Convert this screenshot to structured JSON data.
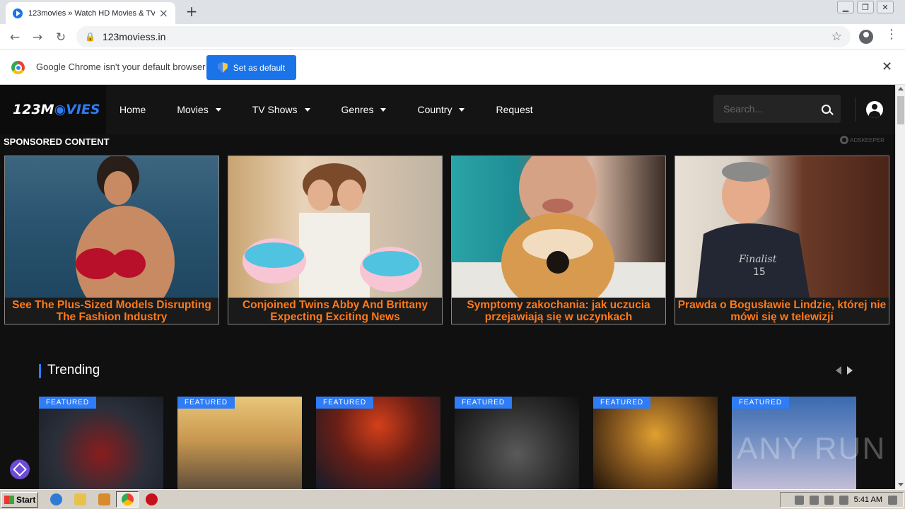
{
  "browser": {
    "tab_title": "123movies » Watch HD Movies & TV",
    "url": "123moviess.in",
    "infobar_message": "Google Chrome isn't your default browser",
    "set_default_label": "Set as default"
  },
  "site": {
    "logo_prefix": "123M",
    "logo_suffix": "VIES",
    "nav": [
      {
        "label": "Home",
        "dropdown": false
      },
      {
        "label": "Movies",
        "dropdown": true
      },
      {
        "label": "TV Shows",
        "dropdown": true
      },
      {
        "label": "Genres",
        "dropdown": true
      },
      {
        "label": "Country",
        "dropdown": true
      },
      {
        "label": "Request",
        "dropdown": false
      }
    ],
    "search_placeholder": "Search..."
  },
  "sponsored": {
    "title": "SPONSORED CONTENT",
    "provider": "ADSKEEPER",
    "cards": [
      {
        "caption": "See The Plus-Sized Models Disrupting The Fashion Industry"
      },
      {
        "caption": "Conjoined Twins Abby And Brittany Expecting Exciting News"
      },
      {
        "caption": "Symptomy zakochania: jak uczucia przejawiają się w uczynkach"
      },
      {
        "caption": "Prawda o Bogusławie Lindzie, której nie mówi się w telewizji"
      }
    ]
  },
  "trending": {
    "title": "Trending",
    "badge": "FEATURED",
    "posters": 6
  },
  "watermark": "ANY RUN",
  "taskbar": {
    "start_label": "Start",
    "clock": "5:41 AM"
  },
  "colors": {
    "accent": "#2e7cf6",
    "caption": "#ff7a1a",
    "site_bg": "#101010"
  }
}
